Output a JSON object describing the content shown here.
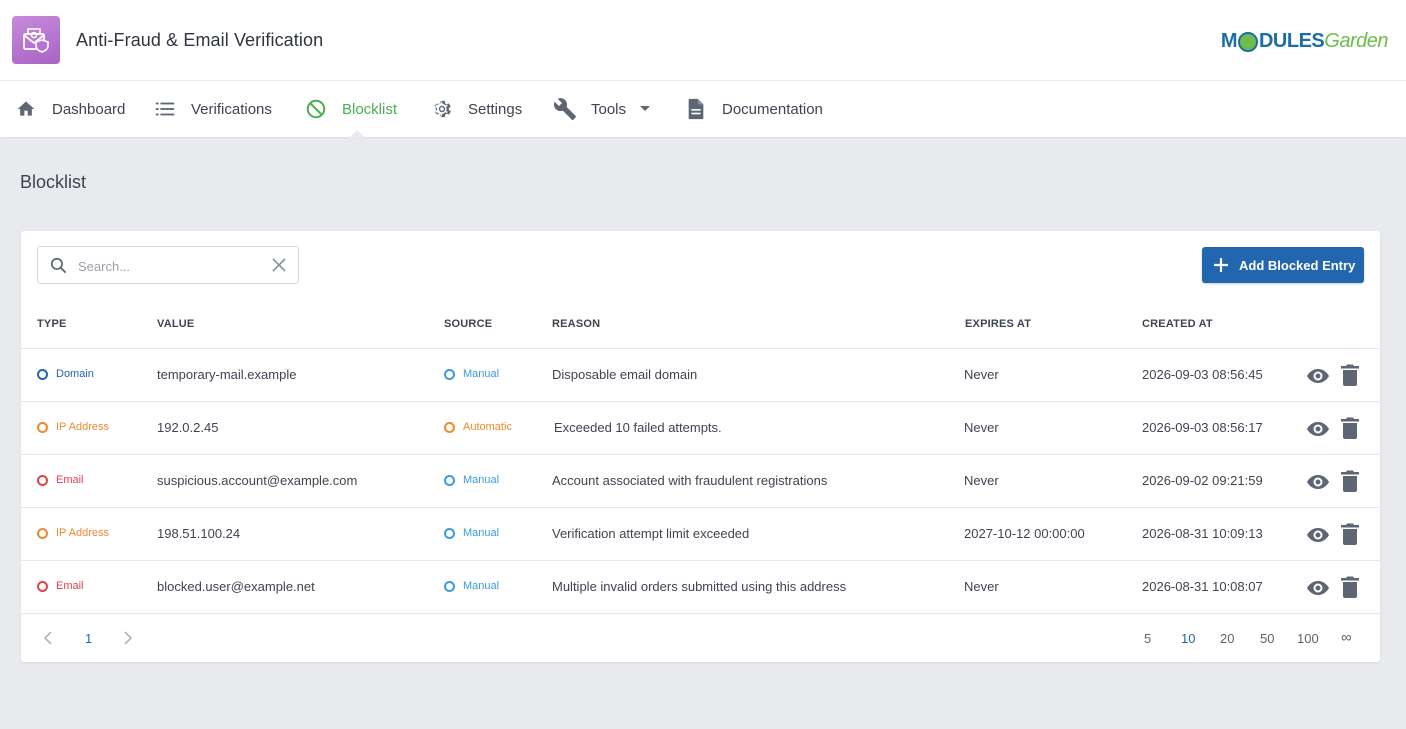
{
  "header": {
    "app_title": "Anti-Fraud & Email Verification",
    "brand_part1": "M",
    "brand_part2": "DULES",
    "brand_part3": "Garden"
  },
  "nav": {
    "items": [
      {
        "label": "Dashboard",
        "icon": "home-icon"
      },
      {
        "label": "Verifications",
        "icon": "list-icon"
      },
      {
        "label": "Blocklist",
        "icon": "block-icon",
        "active": true
      },
      {
        "label": "Settings",
        "icon": "gear-icon"
      },
      {
        "label": "Tools",
        "icon": "wrench-icon",
        "dropdown": true
      },
      {
        "label": "Documentation",
        "icon": "document-icon"
      }
    ]
  },
  "page": {
    "title": "Blocklist"
  },
  "toolbar": {
    "search_placeholder": "Search...",
    "search_value": "",
    "add_label": "Add Blocked Entry"
  },
  "colors": {
    "accent": "#2366b0",
    "active_nav": "#4caf50",
    "domain": "#2366b0",
    "ip": "#f0892b",
    "email": "#e0434b",
    "manual": "#3c9be0",
    "automatic": "#f0892b"
  },
  "table": {
    "headers": {
      "type": "TYPE",
      "value": "VALUE",
      "source": "SOURCE",
      "reason": "REASON",
      "expires": "EXPIRES AT",
      "created": "CREATED AT"
    },
    "rows": [
      {
        "type": "Domain",
        "value": "temporary-mail.example",
        "source": "Manual",
        "reason": "Disposable email domain",
        "expires": "Never",
        "created": "2026-09-03 08:56:45"
      },
      {
        "type": "IP Address",
        "value": "192.0.2.45",
        "source": "Automatic",
        "reason": "Exceeded 10 failed attempts.",
        "expires": "Never",
        "created": "2026-09-03 08:56:17"
      },
      {
        "type": "Email",
        "value": "suspicious.account@example.com",
        "source": "Manual",
        "reason": "Account associated with fraudulent registrations",
        "expires": "Never",
        "created": "2026-09-02 09:21:59"
      },
      {
        "type": "IP Address",
        "value": "198.51.100.24",
        "source": "Manual",
        "reason": "Verification attempt limit exceeded",
        "expires": "2027-10-12 00:00:00",
        "created": "2026-08-31 10:09:13"
      },
      {
        "type": "Email",
        "value": "blocked.user@example.net",
        "source": "Manual",
        "reason": "Multiple invalid orders submitted using this address",
        "expires": "Never",
        "created": "2026-08-31 10:08:07"
      }
    ]
  },
  "pagination": {
    "current_page": "1",
    "page_sizes": [
      "5",
      "10",
      "20",
      "50",
      "100",
      "∞"
    ],
    "selected_size": "10"
  }
}
